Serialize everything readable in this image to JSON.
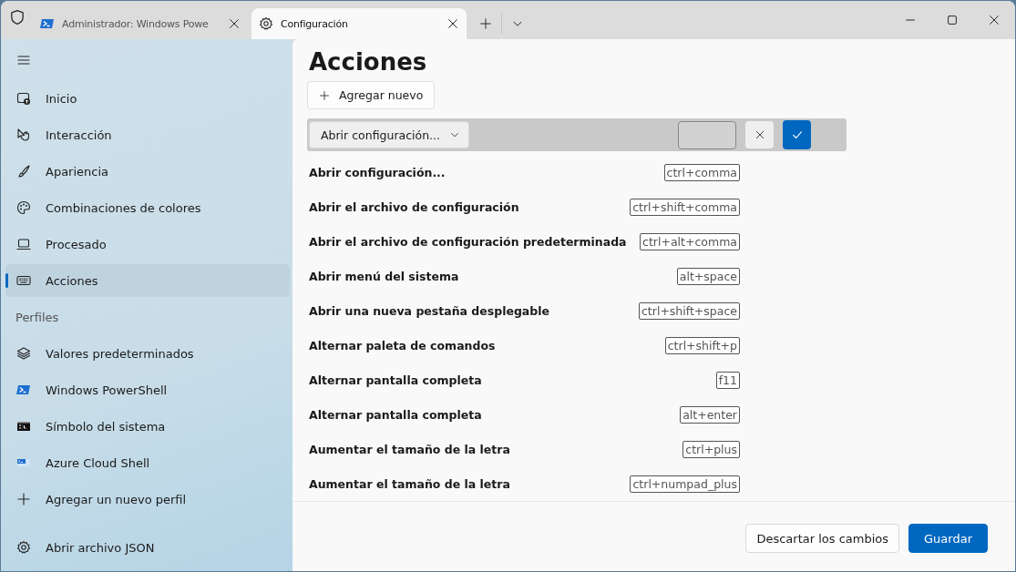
{
  "tabs": [
    {
      "label": "Administrador: Windows Powe",
      "selected": false
    },
    {
      "label": "Configuración",
      "selected": true
    }
  ],
  "sidebar": {
    "items": [
      {
        "kind": "item",
        "label": "Inicio",
        "selected": false
      },
      {
        "kind": "item",
        "label": "Interacción",
        "selected": false
      },
      {
        "kind": "item",
        "label": "Apariencia",
        "selected": false
      },
      {
        "kind": "item",
        "label": "Combinaciones de colores",
        "selected": false
      },
      {
        "kind": "item",
        "label": "Procesado",
        "selected": false
      },
      {
        "kind": "item",
        "label": "Acciones",
        "selected": true
      },
      {
        "kind": "header",
        "label": "Perfiles"
      },
      {
        "kind": "item",
        "label": "Valores predeterminados",
        "selected": false
      },
      {
        "kind": "item",
        "label": "Windows PowerShell",
        "selected": false
      },
      {
        "kind": "item",
        "label": "Símbolo del sistema",
        "selected": false
      },
      {
        "kind": "item",
        "label": "Azure Cloud Shell",
        "selected": false
      },
      {
        "kind": "item",
        "label": "Agregar un nuevo perfil",
        "selected": false
      }
    ],
    "footer_item": {
      "label": "Abrir archivo JSON"
    }
  },
  "page": {
    "title": "Acciones",
    "add_button": "Agregar nuevo",
    "editor": {
      "action_dropdown": "Abrir configuración..."
    },
    "actions": [
      {
        "name": "Abrir configuración...",
        "keys": "ctrl+comma"
      },
      {
        "name": "Abrir el archivo de configuración",
        "keys": "ctrl+shift+comma"
      },
      {
        "name": "Abrir el archivo de configuración predeterminada",
        "keys": "ctrl+alt+comma"
      },
      {
        "name": "Abrir menú del sistema",
        "keys": "alt+space"
      },
      {
        "name": "Abrir una nueva pestaña desplegable",
        "keys": "ctrl+shift+space"
      },
      {
        "name": "Alternar paleta de comandos",
        "keys": "ctrl+shift+p"
      },
      {
        "name": "Alternar pantalla completa",
        "keys": "f11"
      },
      {
        "name": "Alternar pantalla completa",
        "keys": "alt+enter"
      },
      {
        "name": "Aumentar el tamaño de la letra",
        "keys": "ctrl+plus"
      },
      {
        "name": "Aumentar el tamaño de la letra",
        "keys": "ctrl+numpad_plus"
      }
    ]
  },
  "footer": {
    "buttons": [
      {
        "kind": "secondary",
        "label": "Descartar los cambios"
      },
      {
        "kind": "primary",
        "label": "Guardar"
      }
    ]
  }
}
